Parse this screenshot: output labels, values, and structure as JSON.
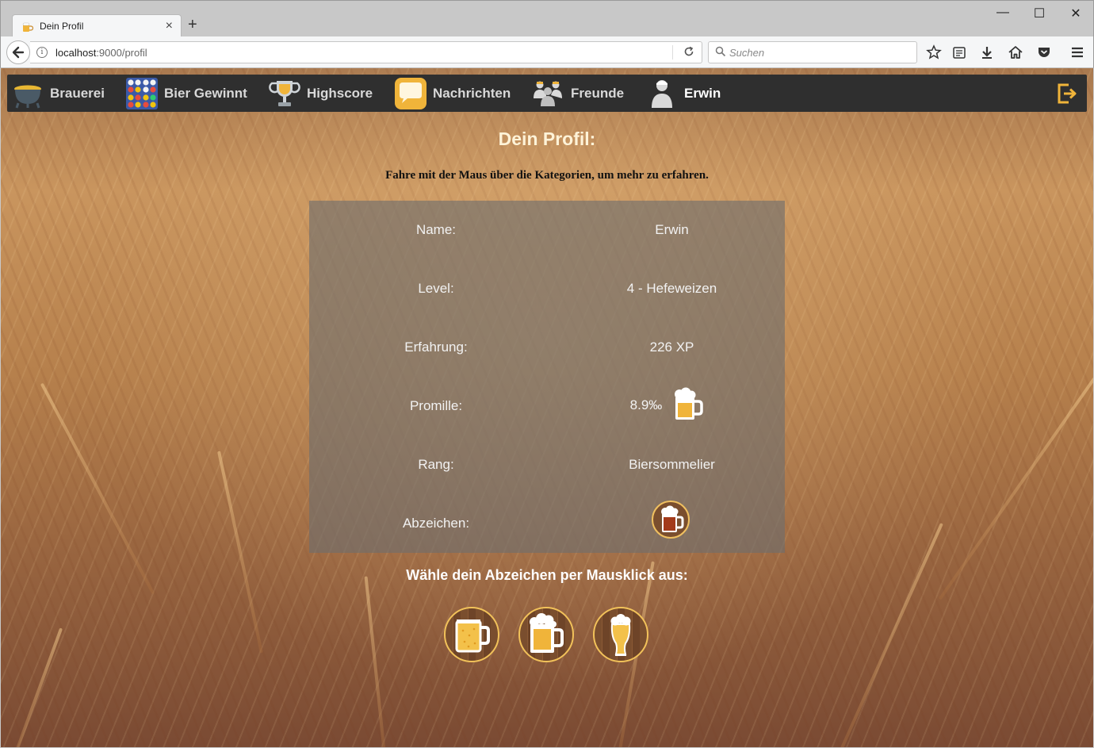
{
  "browser": {
    "tab_title": "Dein Profil",
    "tab_close": "×",
    "new_tab": "+",
    "url_host": "localhost",
    "url_rest": ":9000/profil",
    "search_placeholder": "Suchen",
    "window_controls": {
      "minimize": "—",
      "maximize": "☐",
      "close": "✕"
    }
  },
  "nav": {
    "items": [
      {
        "label": "Brauerei",
        "icon": "cauldron-icon"
      },
      {
        "label": "Bier Gewinnt",
        "icon": "connect-four-icon"
      },
      {
        "label": "Highscore",
        "icon": "trophy-icon"
      },
      {
        "label": "Nachrichten",
        "icon": "speech-bubble-icon"
      },
      {
        "label": "Freunde",
        "icon": "friends-icon"
      },
      {
        "label": "Erwin",
        "icon": "user-icon"
      }
    ],
    "logout_icon": "logout-icon"
  },
  "page": {
    "title": "Dein Profil:",
    "hint": "Fahre mit der Maus über die Kategorien, um mehr zu erfahren.",
    "profile": {
      "name_label": "Name:",
      "name_value": "Erwin",
      "level_label": "Level:",
      "level_value": "4 - Hefeweizen",
      "xp_label": "Erfahrung:",
      "xp_value": "226 XP",
      "promille_label": "Promille:",
      "promille_value": "8.9‰",
      "rank_label": "Rang:",
      "rank_value": "Biersommelier",
      "badge_label": "Abzeichen:"
    },
    "choose_title": "Wähle dein Abzeichen per Mausklick aus:",
    "badge_options": [
      "beer-mug-badge-icon",
      "foamy-beer-mug-badge-icon",
      "wheat-beer-glass-badge-icon"
    ]
  },
  "colors": {
    "nav_bg": "#2f2f2f",
    "accent": "#f2c25a",
    "beer": "#f0b43a"
  }
}
